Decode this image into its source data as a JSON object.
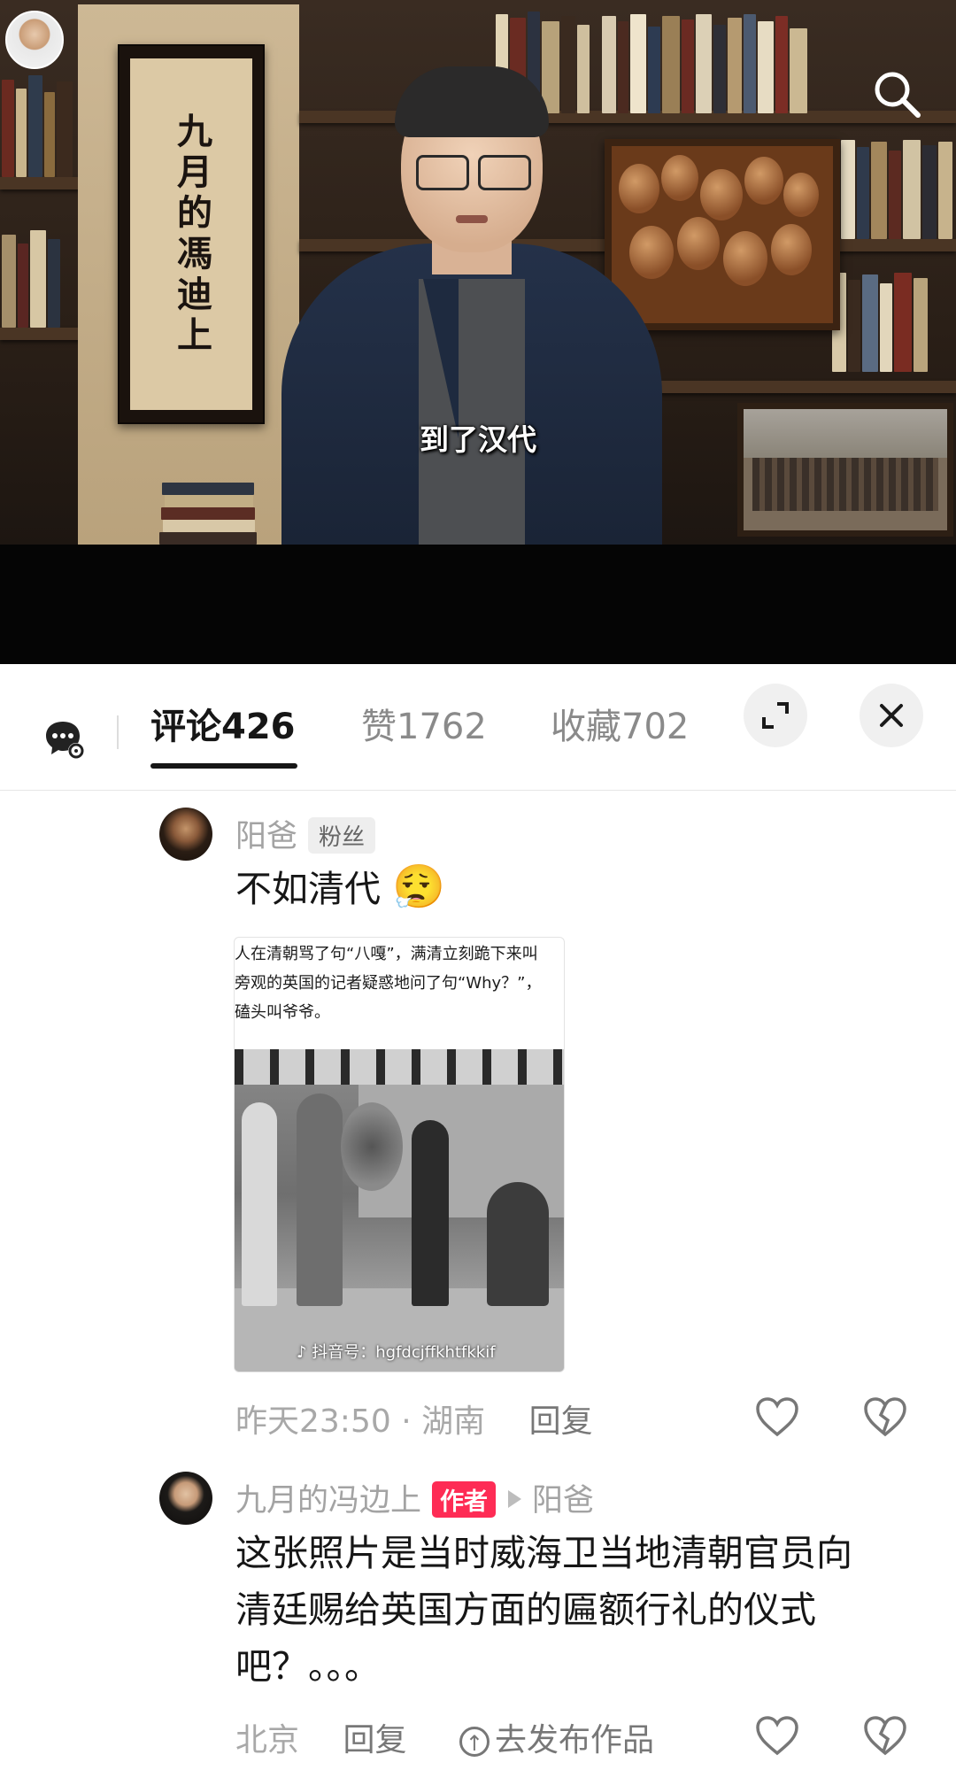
{
  "video": {
    "subtitle": "到了汉代",
    "scroll_text": "九月的馮迪上",
    "top_avatar_icon": "avatar",
    "search_icon": "search-icon"
  },
  "comments_panel": {
    "tabs": [
      {
        "label": "评论",
        "count": "426",
        "active": true
      },
      {
        "label": "赞",
        "count": "1762",
        "active": false
      },
      {
        "label": "收藏",
        "count": "702",
        "active": false
      }
    ],
    "expand_icon": "expand-icon",
    "close_icon": "close-icon"
  },
  "comments": [
    {
      "author": "阳爸",
      "badge": "粉丝",
      "text": "不如清代",
      "emoji": "😮‍💨",
      "image": {
        "caption_lines": [
          "人在清朝骂了句“八嘎”，满清立刻跪下来叫",
          "旁观的英国的记者疑惑地问了句“Why？”，",
          "磕头叫爷爷。"
        ],
        "watermark": "抖音号：hgfdcjffkhtfkkif"
      },
      "time": "昨天23:50",
      "location": "湖南",
      "reply_label": "回复"
    },
    {
      "author": "九月的冯边上",
      "badge": "作者",
      "reply_to": "阳爸",
      "text_lines": [
        "这张照片是当时威海卫当地清朝官员向",
        "清廷赐给英国方面的匾额行礼的仪式",
        "吧？。。。"
      ],
      "location": "北京",
      "reply_label": "回复",
      "publish_label": "去发布作品"
    }
  ],
  "colors": {
    "accent": "#fe2c55",
    "muted_text": "#a3a3a3",
    "primary_text": "#161616"
  }
}
